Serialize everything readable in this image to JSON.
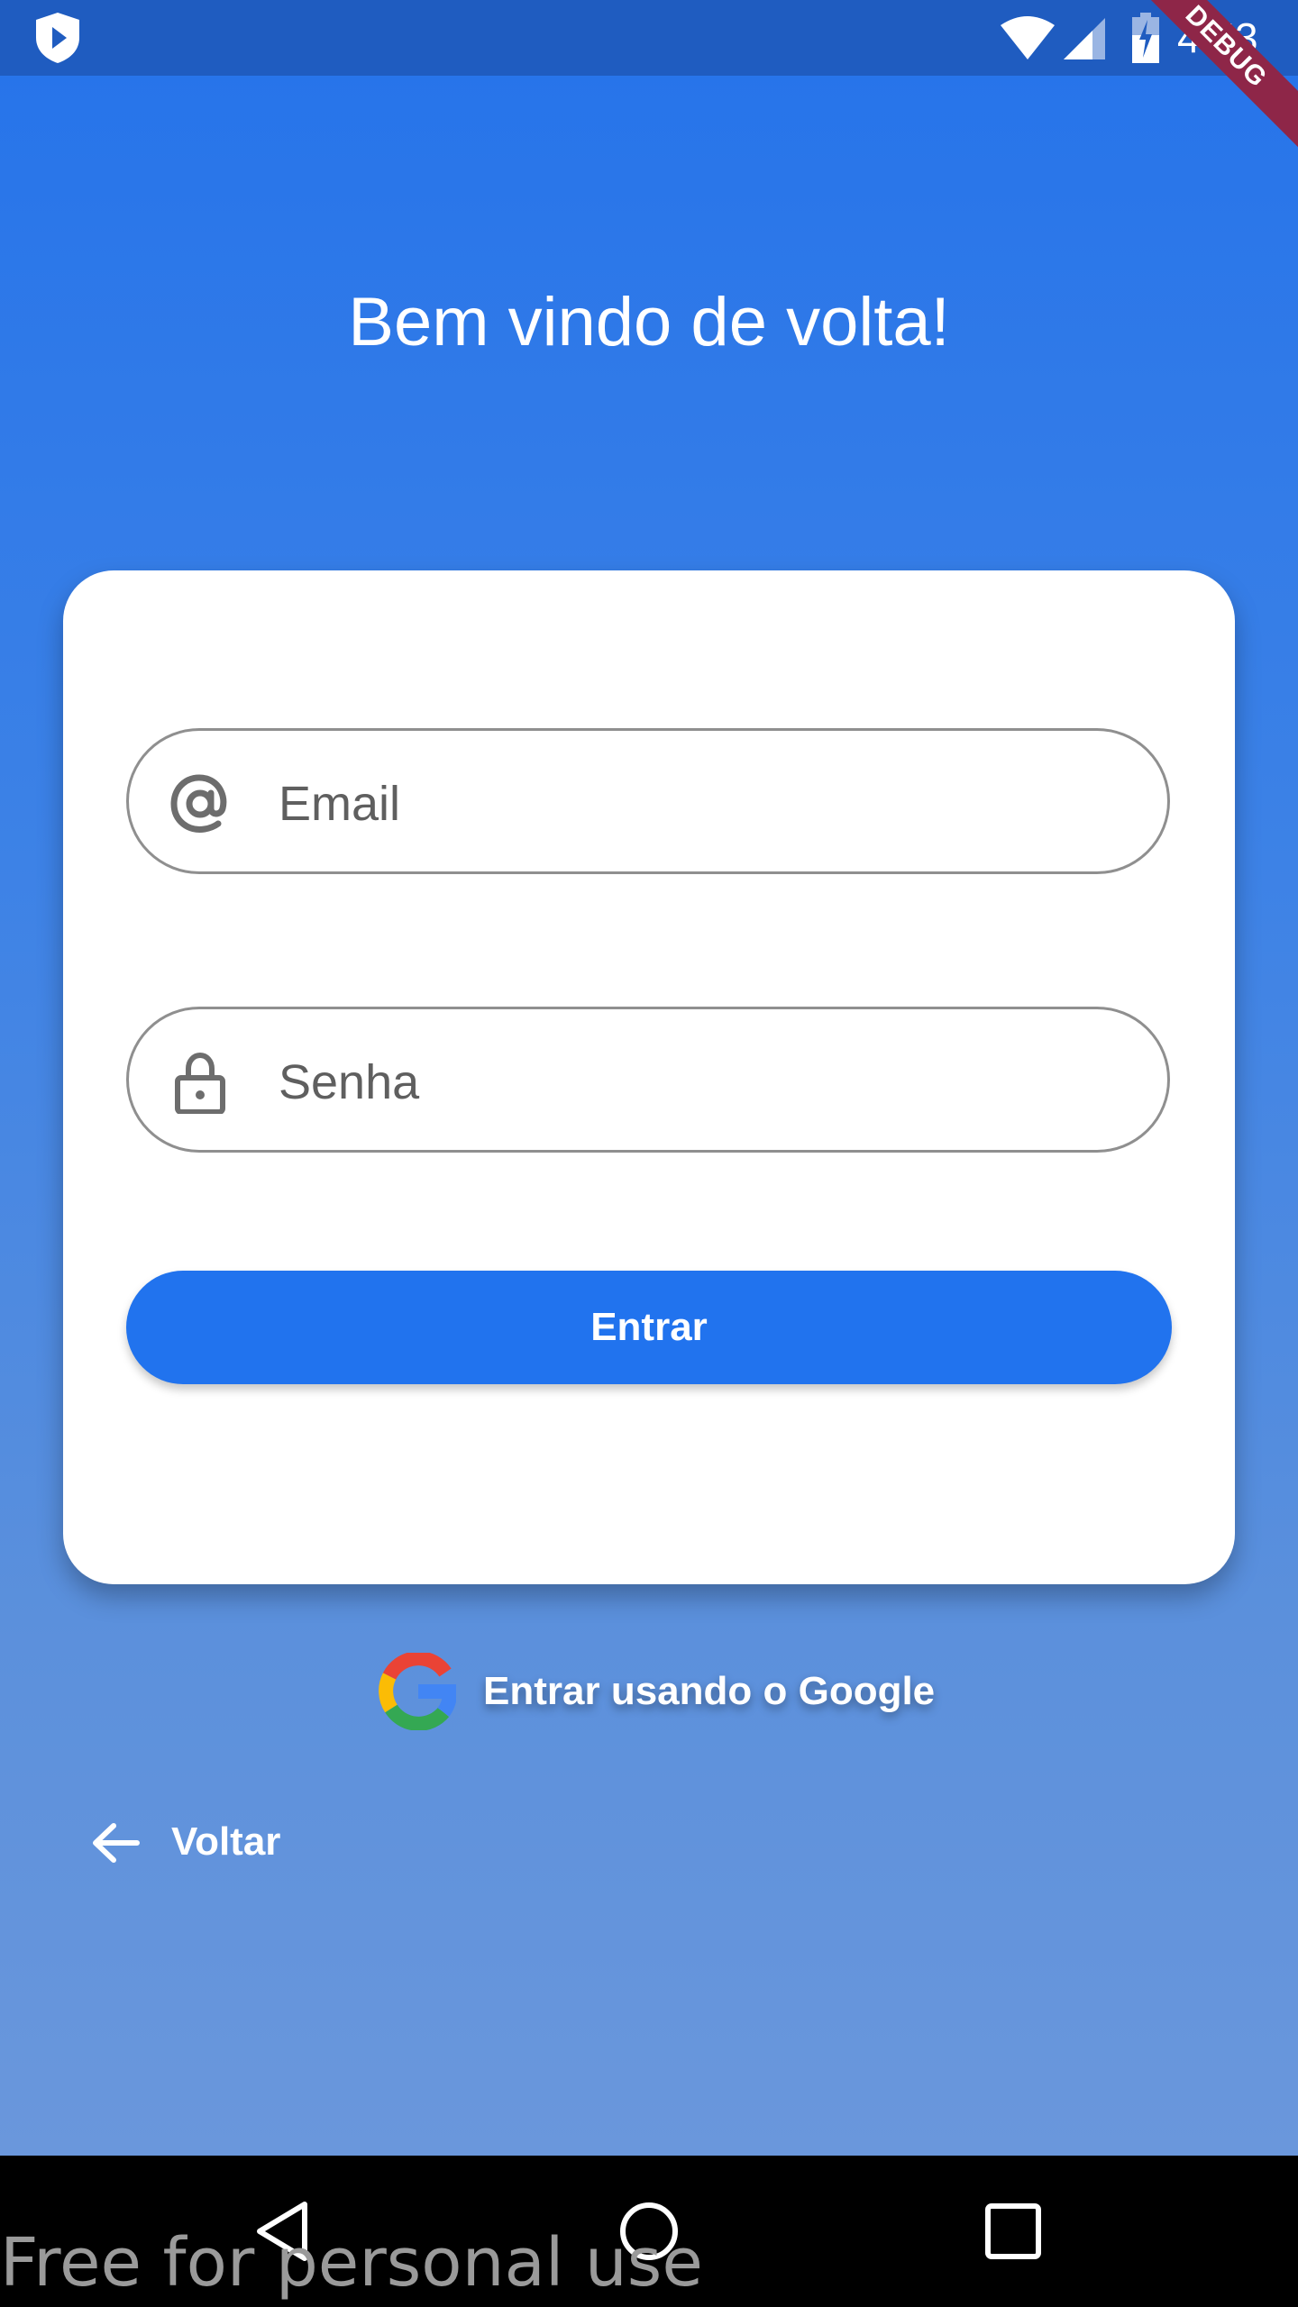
{
  "status_bar": {
    "time": "4:53",
    "icons": [
      "shield-icon",
      "wifi-icon",
      "cell-signal-icon",
      "battery-charging-icon"
    ],
    "debug_label": "DEBUG"
  },
  "title": "Bem vindo de volta!",
  "form": {
    "email_label": "Email",
    "password_label": "Senha",
    "submit_label": "Entrar"
  },
  "google_login_label": "Entrar usando o Google",
  "back_label": "Voltar",
  "watermark": "Free for personal use",
  "colors": {
    "background_top": "#2573ea",
    "background_bottom": "#6a97dc",
    "primary_button": "#2173ee",
    "card": "#ffffff"
  }
}
